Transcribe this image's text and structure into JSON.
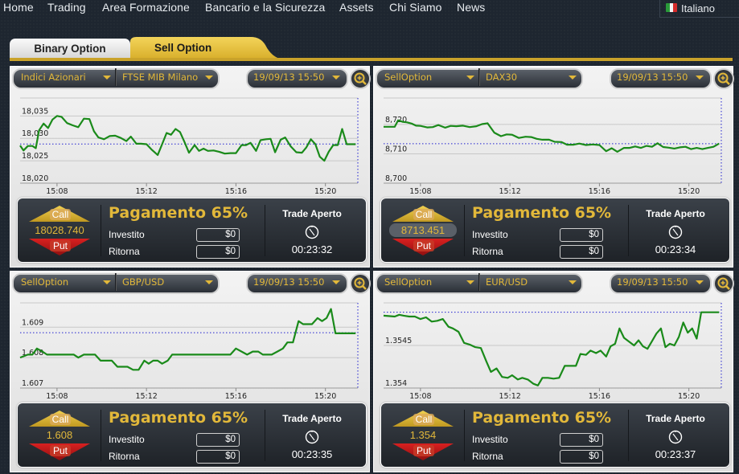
{
  "nav": {
    "items": [
      "Home",
      "Trading",
      "Area Formazione",
      "Bancario e la Sicurezza",
      "Assets",
      "Chi Siamo",
      "News"
    ],
    "language": "Italiano",
    "language_flag_icon": "italy-flag-icon"
  },
  "tabs": [
    {
      "label": "Binary Option",
      "active": false
    },
    {
      "label": "Sell Option",
      "active": true
    }
  ],
  "colors": {
    "accent_gold": "#e2b83a",
    "tab_gold": "#e8c23a",
    "line_green": "#1a8a1a",
    "ref_blue": "#2020d0",
    "call_gold": "#d8b030",
    "put_red": "#b81818"
  },
  "panels": [
    {
      "category": "Indici Azionari",
      "asset": "FTSE MIB Milano",
      "datetime": "19/09/13 15:50",
      "price": "18028.740",
      "price_boxed": false,
      "payout": "Pagamento 65%",
      "invested_label": "Investito",
      "invested_value": "$0",
      "return_label": "Ritorna",
      "return_value": "$0",
      "trade_title": "Trade Aperto",
      "timer": "00:23:32",
      "call_label": "Call",
      "put_label": "Put"
    },
    {
      "category": "SellOption",
      "asset": "DAX30",
      "datetime": "19/09/13 15:50",
      "price": "8713.451",
      "price_boxed": true,
      "payout": "Pagamento 65%",
      "invested_label": "Investito",
      "invested_value": "$0",
      "return_label": "Ritorna",
      "return_value": "$0",
      "trade_title": "Trade Aperto",
      "timer": "00:23:34",
      "call_label": "Call",
      "put_label": "Put"
    },
    {
      "category": "SellOption",
      "asset": "GBP/USD",
      "datetime": "19/09/13 15:50",
      "price": "1.608",
      "price_boxed": false,
      "payout": "Pagamento 65%",
      "invested_label": "Investito",
      "invested_value": "$0",
      "return_label": "Ritorna",
      "return_value": "$0",
      "trade_title": "Trade Aperto",
      "timer": "00:23:35",
      "call_label": "Call",
      "put_label": "Put"
    },
    {
      "category": "SellOption",
      "asset": "EUR/USD",
      "datetime": "19/09/13 15:50",
      "price": "1.354",
      "price_boxed": false,
      "payout": "Pagamento 65%",
      "invested_label": "Investito",
      "invested_value": "$0",
      "return_label": "Ritorna",
      "return_value": "$0",
      "trade_title": "Trade Aperto",
      "timer": "00:23:37",
      "call_label": "Call",
      "put_label": "Put"
    }
  ],
  "chart_data": [
    {
      "type": "line",
      "title": "FTSE MIB Milano",
      "x_range_minutes": [
        15.1,
        21.6
      ],
      "x_ticks": [
        {
          "v": 8,
          "label": "15:08"
        },
        {
          "v": 12,
          "label": "15:12"
        },
        {
          "v": 16,
          "label": "15:16"
        },
        {
          "v": 20,
          "label": "15:20"
        }
      ],
      "y_ticks": [
        {
          "v": 18020,
          "label": "18,020"
        },
        {
          "v": 18025,
          "label": "18,025"
        },
        {
          "v": 18030,
          "label": "18,030"
        },
        {
          "v": 18035,
          "label": "18,035"
        }
      ],
      "ylim": [
        18020,
        18039
      ],
      "reference": 18028.74,
      "grid": true,
      "x": [
        6.35,
        6.5,
        6.7,
        6.9,
        7.05,
        7.2,
        7.4,
        7.6,
        7.8,
        8.0,
        8.2,
        8.45,
        8.7,
        8.95,
        9.2,
        9.45,
        9.65,
        9.85,
        10.1,
        10.35,
        10.6,
        10.85,
        11.1,
        11.3,
        11.55,
        11.75,
        12.0,
        12.25,
        12.5,
        12.7,
        12.9,
        13.1,
        13.3,
        13.5,
        13.7,
        13.9,
        14.15,
        14.35,
        14.55,
        14.75,
        15.0,
        15.25,
        15.5,
        15.75,
        16.0,
        16.25,
        16.45,
        16.65,
        16.9,
        17.1,
        17.35,
        17.55,
        17.75,
        18.0,
        18.2,
        18.45,
        18.7,
        18.95,
        19.15,
        19.35,
        19.55,
        19.75,
        19.95,
        20.15,
        20.35,
        20.55,
        20.75,
        20.95,
        21.15,
        21.35
      ],
      "y": [
        18028.4,
        18027.3,
        18028.3,
        18028.3,
        18027.8,
        18031.8,
        18033.3,
        18032.3,
        18034.2,
        18035.0,
        18034.8,
        18033.4,
        18032.9,
        18032.5,
        18034.4,
        18034.3,
        18031.6,
        18030.2,
        18029.8,
        18030.5,
        18030.6,
        18030.1,
        18029.4,
        18030.4,
        18028.8,
        18028.8,
        18028.7,
        18027.4,
        18026.3,
        18028.7,
        18031.2,
        18030.8,
        18032.1,
        18031.4,
        18029.2,
        18026.8,
        18028.5,
        18027.2,
        18027.7,
        18027.2,
        18027.3,
        18027.0,
        18026.6,
        18026.7,
        18026.7,
        18028.5,
        18028.5,
        18029.0,
        18027.2,
        18029.6,
        18029.8,
        18029.9,
        18026.9,
        18029.7,
        18030.2,
        18028.2,
        18026.9,
        18026.8,
        18028.0,
        18029.8,
        18028.7,
        18025.9,
        18025.0,
        18027.0,
        18028.5,
        18028.5,
        18032.1,
        18028.7,
        18028.7,
        18028.7
      ]
    },
    {
      "type": "line",
      "title": "DAX30",
      "x_range_minutes": [
        15.1,
        21.6
      ],
      "x_ticks": [
        {
          "v": 8,
          "label": "15:08"
        },
        {
          "v": 12,
          "label": "15:12"
        },
        {
          "v": 16,
          "label": "15:16"
        },
        {
          "v": 20,
          "label": "15:20"
        }
      ],
      "y_ticks": [
        {
          "v": 8700,
          "label": "8,700"
        },
        {
          "v": 8710,
          "label": "8,710"
        },
        {
          "v": 8720,
          "label": "8,720"
        }
      ],
      "ylim": [
        8700,
        8729
      ],
      "reference": 8713.451,
      "grid": true,
      "x": [
        6.35,
        6.85,
        7.0,
        7.2,
        7.4,
        7.6,
        7.8,
        8.0,
        8.3,
        8.55,
        8.8,
        9.1,
        9.35,
        9.6,
        9.9,
        10.2,
        10.5,
        10.75,
        11.0,
        11.3,
        11.6,
        11.85,
        12.1,
        12.4,
        12.7,
        12.95,
        13.2,
        13.45,
        13.75,
        14.0,
        14.3,
        14.55,
        14.85,
        15.1,
        15.4,
        15.7,
        16.0,
        16.3,
        16.55,
        16.8,
        17.1,
        17.35,
        17.6,
        17.85,
        18.1,
        18.35,
        18.6,
        18.85,
        19.1,
        19.35,
        19.6,
        19.85,
        20.1,
        20.35,
        20.6,
        20.85,
        21.1,
        21.35
      ],
      "y": [
        8719.2,
        8719.2,
        8721.4,
        8720.9,
        8720.7,
        8720.3,
        8719.6,
        8719.5,
        8719.0,
        8719.1,
        8719.8,
        8718.9,
        8719.5,
        8719.4,
        8719.6,
        8719.1,
        8719.4,
        8720.1,
        8720.4,
        8717.2,
        8716.0,
        8716.6,
        8716.5,
        8715.4,
        8715.8,
        8715.7,
        8715.1,
        8714.8,
        8714.8,
        8714.1,
        8714.0,
        8713.1,
        8713.1,
        8713.5,
        8713.0,
        8713.2,
        8713.0,
        8710.9,
        8711.9,
        8710.7,
        8712.0,
        8712.0,
        8712.5,
        8712.0,
        8712.7,
        8712.4,
        8713.6,
        8712.3,
        8712.1,
        8711.8,
        8712.2,
        8712.4,
        8711.6,
        8712.0,
        8711.6,
        8712.0,
        8712.4,
        8713.5
      ]
    },
    {
      "type": "line",
      "title": "GBP/USD",
      "x_range_minutes": [
        15.1,
        21.6
      ],
      "x_ticks": [
        {
          "v": 8,
          "label": "15:08"
        },
        {
          "v": 12,
          "label": "15:12"
        },
        {
          "v": 16,
          "label": "15:16"
        },
        {
          "v": 20,
          "label": "15:20"
        }
      ],
      "y_ticks": [
        {
          "v": 1.607,
          "label": "1.607"
        },
        {
          "v": 1.608,
          "label": "1.608"
        },
        {
          "v": 1.609,
          "label": "1.609"
        }
      ],
      "ylim": [
        1.607,
        1.6098
      ],
      "reference": 1.60882,
      "grid": true,
      "x": [
        6.35,
        6.7,
        6.9,
        7.1,
        7.35,
        7.55,
        7.8,
        8.0,
        8.25,
        8.5,
        8.75,
        8.95,
        9.2,
        9.45,
        9.7,
        9.95,
        10.2,
        10.45,
        10.7,
        10.95,
        11.15,
        11.4,
        11.65,
        11.9,
        12.1,
        12.3,
        12.5,
        12.7,
        12.95,
        13.15,
        13.4,
        13.65,
        13.85,
        14.1,
        14.3,
        14.55,
        14.8,
        15.05,
        15.3,
        15.5,
        15.75,
        16.0,
        16.25,
        16.5,
        16.75,
        17.0,
        17.2,
        17.4,
        17.6,
        17.85,
        18.1,
        18.3,
        18.55,
        18.8,
        19.0,
        19.2,
        19.4,
        19.65,
        19.85,
        20.05,
        20.25,
        20.45,
        20.65,
        20.85,
        21.05,
        21.35
      ],
      "y": [
        1.608,
        1.6081,
        1.6081,
        1.6083,
        1.6082,
        1.6081,
        1.6081,
        1.6081,
        1.6081,
        1.6081,
        1.6081,
        1.608,
        1.6081,
        1.6081,
        1.6081,
        1.6079,
        1.6079,
        1.6079,
        1.6077,
        1.6077,
        1.6077,
        1.6076,
        1.6076,
        1.6079,
        1.6078,
        1.6079,
        1.6079,
        1.6078,
        1.6079,
        1.6081,
        1.6081,
        1.6081,
        1.6081,
        1.6081,
        1.6081,
        1.6081,
        1.6081,
        1.6081,
        1.6081,
        1.6081,
        1.6081,
        1.6083,
        1.6082,
        1.6081,
        1.6082,
        1.6082,
        1.6081,
        1.6081,
        1.6081,
        1.6082,
        1.6083,
        1.6085,
        1.6085,
        1.6092,
        1.6091,
        1.6091,
        1.6091,
        1.6093,
        1.6092,
        1.6093,
        1.6096,
        1.6088,
        1.6088,
        1.6088,
        1.6088,
        1.6088
      ]
    },
    {
      "type": "line",
      "title": "EUR/USD",
      "x_range_minutes": [
        15.1,
        21.6
      ],
      "x_ticks": [
        {
          "v": 8,
          "label": "15:08"
        },
        {
          "v": 12,
          "label": "15:12"
        },
        {
          "v": 16,
          "label": "15:16"
        },
        {
          "v": 20,
          "label": "15:20"
        }
      ],
      "y_ticks": [
        {
          "v": 1.354,
          "label": "1.354"
        },
        {
          "v": 1.3545,
          "label": "1.3545"
        }
      ],
      "ylim": [
        1.354,
        1.355
      ],
      "reference": 1.35489,
      "grid": true,
      "x": [
        6.35,
        6.85,
        7.05,
        7.25,
        7.5,
        7.75,
        8.0,
        8.25,
        8.5,
        8.75,
        9.0,
        9.25,
        9.45,
        9.7,
        9.95,
        10.2,
        10.45,
        10.7,
        10.95,
        11.15,
        11.4,
        11.65,
        11.9,
        12.1,
        12.35,
        12.55,
        12.8,
        13.05,
        13.25,
        13.45,
        13.7,
        13.95,
        14.2,
        14.45,
        14.7,
        14.95,
        15.15,
        15.4,
        15.6,
        15.85,
        16.05,
        16.3,
        16.5,
        16.7,
        16.9,
        17.1,
        17.3,
        17.55,
        17.75,
        17.95,
        18.15,
        18.35,
        18.55,
        18.75,
        18.95,
        19.15,
        19.35,
        19.55,
        19.75,
        19.95,
        20.15,
        20.35,
        20.55,
        20.75,
        21.0,
        21.15,
        21.35
      ],
      "y": [
        1.35485,
        1.35484,
        1.35486,
        1.35485,
        1.35484,
        1.35484,
        1.35481,
        1.35483,
        1.35478,
        1.35479,
        1.35481,
        1.35472,
        1.3547,
        1.35466,
        1.35453,
        1.35451,
        1.35448,
        1.35447,
        1.35431,
        1.35419,
        1.35423,
        1.35413,
        1.35412,
        1.35415,
        1.3541,
        1.35412,
        1.3541,
        1.35405,
        1.35403,
        1.35412,
        1.35412,
        1.35411,
        1.35412,
        1.35426,
        1.35426,
        1.35426,
        1.3544,
        1.35439,
        1.35444,
        1.35441,
        1.35444,
        1.35437,
        1.35449,
        1.35452,
        1.3547,
        1.35459,
        1.35455,
        1.3545,
        1.35456,
        1.35449,
        1.35446,
        1.35455,
        1.35464,
        1.3547,
        1.35448,
        1.35452,
        1.3545,
        1.3546,
        1.35477,
        1.35465,
        1.3547,
        1.35458,
        1.35489,
        1.35489,
        1.35489,
        1.35489,
        1.35489
      ]
    }
  ]
}
